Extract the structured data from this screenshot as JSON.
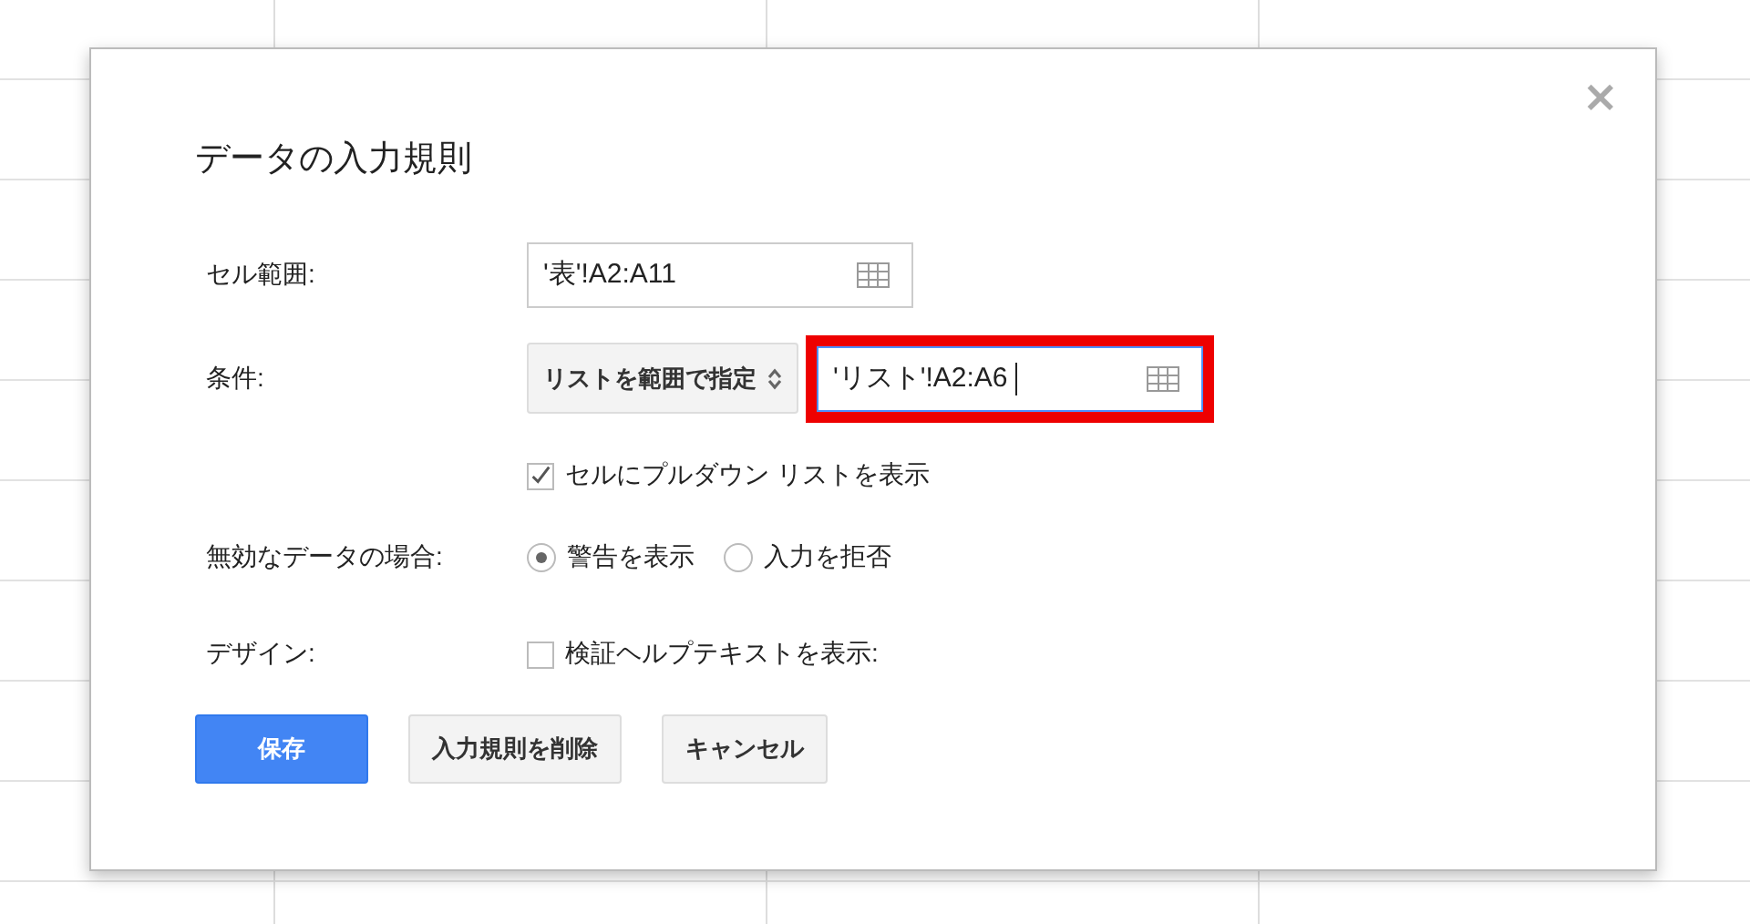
{
  "dialog": {
    "title": "データの入力規則",
    "close": "×",
    "cell_range": {
      "label": "セル範囲:",
      "value": "'表'!A2:A11"
    },
    "criteria": {
      "label": "条件:",
      "dropdown": "リストを範囲で指定",
      "value": "'リスト'!A2:A6",
      "focused": true,
      "highlighted": true
    },
    "show_dropdown": {
      "label": "セルにプルダウン リストを表示",
      "checked": true
    },
    "invalid_data": {
      "label": "無効なデータの場合:",
      "options": [
        {
          "label": "警告を表示",
          "selected": true
        },
        {
          "label": "入力を拒否",
          "selected": false
        }
      ]
    },
    "design": {
      "label": "デザイン:",
      "help_text": {
        "label": "検証ヘルプテキストを表示:",
        "checked": false
      }
    },
    "buttons": [
      {
        "label": "保存",
        "kind": "primary"
      },
      {
        "label": "入力規則を削除",
        "kind": "secondary"
      },
      {
        "label": "キャンセル",
        "kind": "secondary"
      }
    ]
  }
}
